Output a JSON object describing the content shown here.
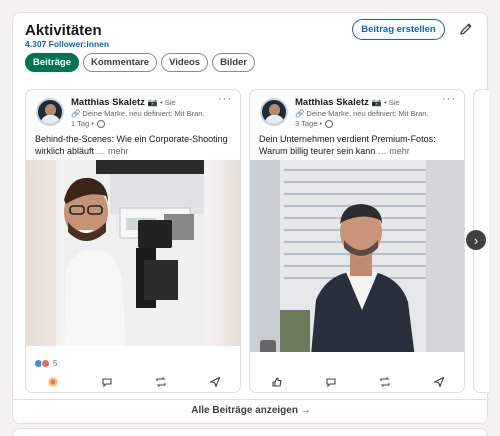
{
  "section": {
    "title": "Aktivitäten",
    "followers": "4.307 Follower:innen",
    "create_button": "Beitrag erstellen"
  },
  "tabs": [
    {
      "label": "Beiträge",
      "active": true
    },
    {
      "label": "Kommentare",
      "active": false
    },
    {
      "label": "Videos",
      "active": false
    },
    {
      "label": "Bilder",
      "active": false
    }
  ],
  "posts": [
    {
      "author": "Matthias Skaletz",
      "camera_emoji": "📷",
      "tier": "• Sie",
      "headline": "🔗 Deine Marke, neu definiert: Mit Bran…",
      "time": "1 Tag •",
      "text": "Behind-the-Scenes: Wie ein Corporate-Shooting wirklich abläuft",
      "more": "… mehr",
      "reactions_count": "5"
    },
    {
      "author": "Matthias Skaletz",
      "camera_emoji": "📷",
      "tier": "• Sie",
      "headline": "🔗 Deine Marke, neu definiert: Mit Bran…",
      "time": "3 Tage •",
      "text": "Dein Unternehmen verdient Premium-Fotos: Warum billig teurer sein kann",
      "more": "… mehr"
    }
  ],
  "show_all": "Alle Beiträge anzeigen →",
  "icons": {
    "edit": "pencil-icon",
    "next": "chevron-right-icon",
    "more": "more-icon",
    "globe": "globe-icon",
    "actions": [
      "like-icon",
      "comment-icon",
      "repost-icon",
      "send-icon"
    ]
  },
  "colors": {
    "brand_blue": "#0a66c2",
    "active_tab": "#01754f"
  }
}
